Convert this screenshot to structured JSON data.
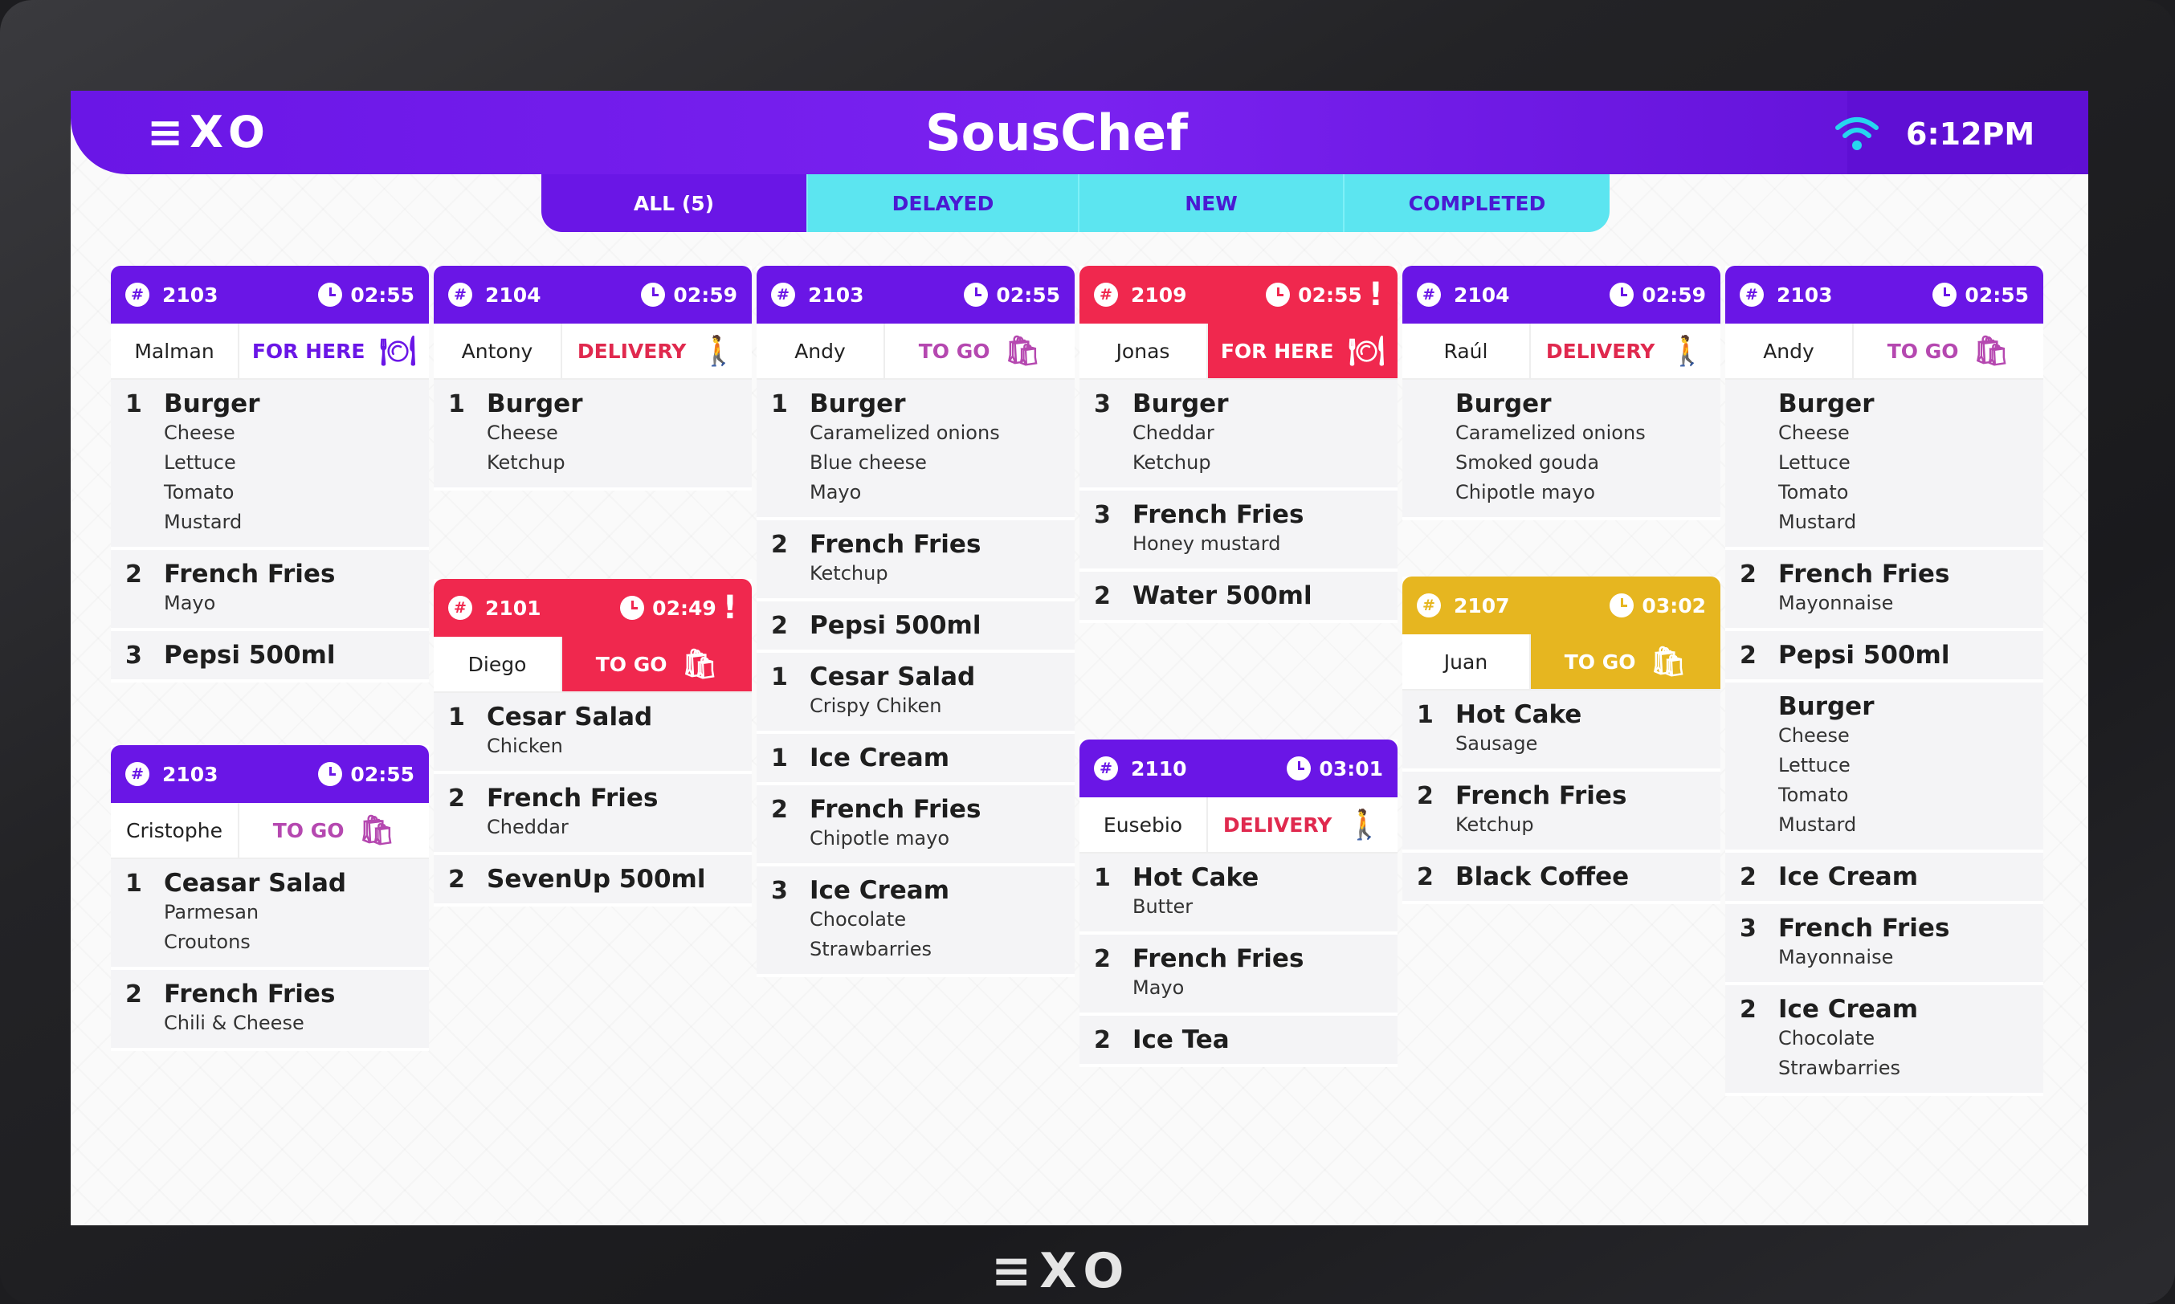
{
  "app": {
    "title": "SousChef",
    "logo": "≡XO",
    "time": "6:12PM",
    "wifi_icon": "wifi-icon"
  },
  "tabs": [
    {
      "label": "ALL (5)",
      "active": true
    },
    {
      "label": "DELAYED",
      "active": false
    },
    {
      "label": "NEW",
      "active": false
    },
    {
      "label": "COMPLETED",
      "active": false
    }
  ],
  "device": {
    "logo": "≡XO"
  },
  "colors": {
    "purple": "#6a16e6",
    "red": "#f0284e",
    "yellow": "#e6b620",
    "cyan": "#5ce5f0"
  },
  "orders": [
    {
      "number": "2103",
      "timer": "02:55",
      "customer": "Malman",
      "type": "FOR HERE",
      "status": "normal",
      "items": [
        {
          "qty": "1",
          "name": "Burger",
          "mods": [
            "Cheese",
            "Lettuce",
            "Tomato",
            "Mustard"
          ]
        },
        {
          "qty": "2",
          "name": "French Fries",
          "mods": [
            "Mayo"
          ]
        },
        {
          "qty": "3",
          "name": "Pepsi 500ml",
          "mods": []
        }
      ]
    },
    {
      "number": "2103",
      "timer": "02:55",
      "customer": "Cristophe",
      "type": "TO GO",
      "status": "normal",
      "items": [
        {
          "qty": "1",
          "name": "Ceasar Salad",
          "mods": [
            "Parmesan",
            "Croutons"
          ]
        },
        {
          "qty": "2",
          "name": "French Fries",
          "mods": [
            "Chili & Cheese"
          ]
        }
      ]
    },
    {
      "number": "2104",
      "timer": "02:59",
      "customer": "Antony",
      "type": "DELIVERY",
      "status": "normal",
      "items": [
        {
          "qty": "1",
          "name": "Burger",
          "mods": [
            "Cheese",
            "Ketchup"
          ]
        }
      ]
    },
    {
      "number": "2101",
      "timer": "02:49",
      "customer": "Diego",
      "type": "TO GO",
      "status": "delayed",
      "items": [
        {
          "qty": "1",
          "name": "Cesar Salad",
          "mods": [
            "Chicken"
          ]
        },
        {
          "qty": "2",
          "name": "French Fries",
          "mods": [
            "Cheddar"
          ]
        },
        {
          "qty": "2",
          "name": "SevenUp 500ml",
          "mods": []
        }
      ]
    },
    {
      "number": "2103",
      "timer": "02:55",
      "customer": "Andy",
      "type": "TO GO",
      "status": "normal",
      "items": [
        {
          "qty": "1",
          "name": "Burger",
          "mods": [
            "Caramelized onions",
            "Blue cheese",
            "Mayo"
          ]
        },
        {
          "qty": "2",
          "name": "French Fries",
          "mods": [
            "Ketchup"
          ]
        },
        {
          "qty": "2",
          "name": "Pepsi 500ml",
          "mods": []
        },
        {
          "qty": "1",
          "name": "Cesar Salad",
          "mods": [
            "Crispy Chiken"
          ]
        },
        {
          "qty": "1",
          "name": "Ice Cream",
          "mods": []
        },
        {
          "qty": "2",
          "name": "French Fries",
          "mods": [
            "Chipotle mayo"
          ]
        },
        {
          "qty": "3",
          "name": "Ice Cream",
          "mods": [
            "Chocolate",
            "Strawbarries"
          ]
        }
      ]
    },
    {
      "number": "2109",
      "timer": "02:55",
      "customer": "Jonas",
      "type": "FOR HERE",
      "status": "delayed",
      "items": [
        {
          "qty": "3",
          "name": "Burger",
          "mods": [
            "Cheddar",
            "Ketchup"
          ]
        },
        {
          "qty": "3",
          "name": "French Fries",
          "mods": [
            "Honey mustard"
          ]
        },
        {
          "qty": "2",
          "name": "Water 500ml",
          "mods": []
        }
      ]
    },
    {
      "number": "2110",
      "timer": "03:01",
      "customer": "Eusebio",
      "type": "DELIVERY",
      "status": "normal",
      "items": [
        {
          "qty": "1",
          "name": "Hot Cake",
          "mods": [
            "Butter"
          ]
        },
        {
          "qty": "2",
          "name": "French Fries",
          "mods": [
            "Mayo"
          ]
        },
        {
          "qty": "2",
          "name": "Ice Tea",
          "mods": []
        }
      ]
    },
    {
      "number": "2104",
      "timer": "02:59",
      "customer": "Raúl",
      "type": "DELIVERY",
      "status": "normal",
      "items": [
        {
          "qty": "",
          "name": "Burger",
          "mods": [
            "Caramelized onions",
            "Smoked gouda",
            "Chipotle mayo"
          ]
        }
      ]
    },
    {
      "number": "2107",
      "timer": "03:02",
      "customer": "Juan",
      "type": "TO GO",
      "status": "new",
      "items": [
        {
          "qty": "1",
          "name": "Hot Cake",
          "mods": [
            "Sausage"
          ]
        },
        {
          "qty": "2",
          "name": "French Fries",
          "mods": [
            "Ketchup"
          ]
        },
        {
          "qty": "2",
          "name": "Black Coffee",
          "mods": []
        }
      ]
    },
    {
      "number": "2103",
      "timer": "02:55",
      "customer": "Andy",
      "type": "TO GO",
      "status": "normal",
      "items": [
        {
          "qty": "",
          "name": "Burger",
          "mods": [
            "Cheese",
            "Lettuce",
            "Tomato",
            "Mustard"
          ]
        },
        {
          "qty": "2",
          "name": "French Fries",
          "mods": [
            "Mayonnaise"
          ]
        },
        {
          "qty": "2",
          "name": "Pepsi 500ml",
          "mods": []
        },
        {
          "qty": "",
          "name": "Burger",
          "mods": [
            "Cheese",
            "Lettuce",
            "Tomato",
            "Mustard"
          ]
        },
        {
          "qty": "2",
          "name": "Ice Cream",
          "mods": []
        },
        {
          "qty": "3",
          "name": "French Fries",
          "mods": [
            "Mayonnaise"
          ]
        },
        {
          "qty": "2",
          "name": "Ice Cream",
          "mods": [
            "Chocolate",
            "Strawbarries"
          ]
        }
      ]
    }
  ]
}
